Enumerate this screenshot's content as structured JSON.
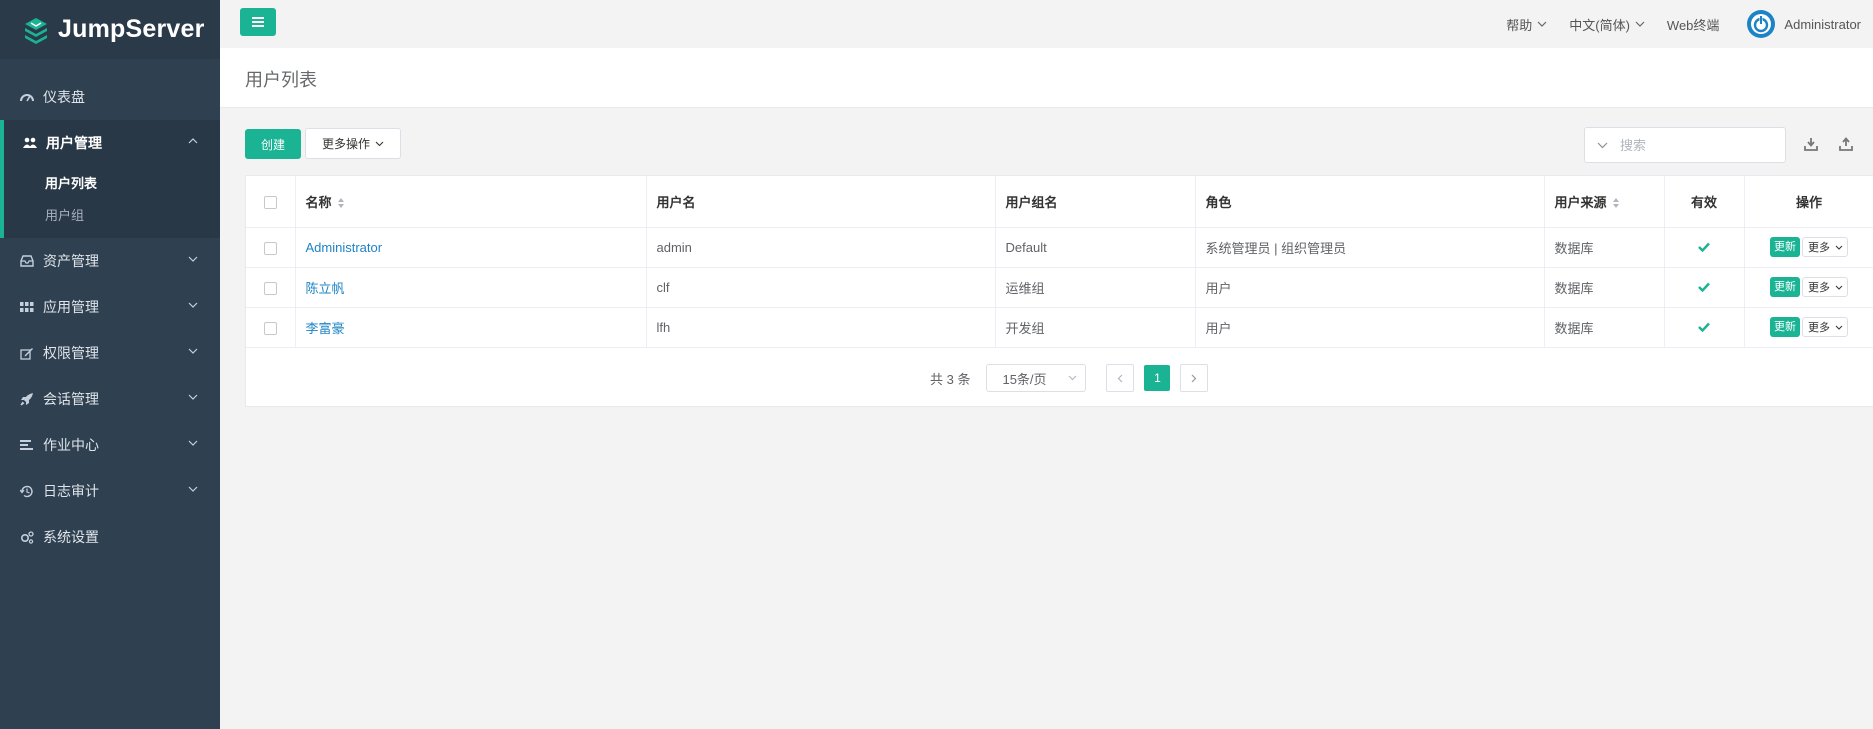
{
  "app": {
    "logo_text": "JumpServer"
  },
  "sidebar": {
    "items": [
      {
        "label": "仪表盘",
        "icon": "dashboard-icon"
      },
      {
        "label": "用户管理",
        "icon": "users-icon",
        "expanded": true,
        "children": [
          {
            "label": "用户列表",
            "current": true
          },
          {
            "label": "用户组"
          }
        ]
      },
      {
        "label": "资产管理",
        "icon": "inbox-icon"
      },
      {
        "label": "应用管理",
        "icon": "grid-icon"
      },
      {
        "label": "权限管理",
        "icon": "edit-icon"
      },
      {
        "label": "会话管理",
        "icon": "rocket-icon"
      },
      {
        "label": "作业中心",
        "icon": "tasks-icon"
      },
      {
        "label": "日志审计",
        "icon": "history-icon"
      },
      {
        "label": "系统设置",
        "icon": "gears-icon"
      }
    ]
  },
  "topbar": {
    "help": "帮助",
    "language": "中文(简体)",
    "web_terminal": "Web终端",
    "user": "Administrator"
  },
  "page": {
    "title": "用户列表"
  },
  "toolbar": {
    "create": "创建",
    "more_actions": "更多操作",
    "search_placeholder": "搜索"
  },
  "table": {
    "headers": {
      "name": "名称",
      "username": "用户名",
      "groups": "用户组名",
      "role": "角色",
      "source": "用户来源",
      "active": "有效",
      "actions": "操作"
    },
    "rows": [
      {
        "name": "Administrator",
        "username": "admin",
        "groups": "Default",
        "role": "系统管理员 | 组织管理员",
        "source": "数据库",
        "active": true,
        "update": "更新",
        "more": "更多"
      },
      {
        "name": "陈立帆",
        "username": "clf",
        "groups": "运维组",
        "role": "用户",
        "source": "数据库",
        "active": true,
        "update": "更新",
        "more": "更多"
      },
      {
        "name": "李富豪",
        "username": "lfh",
        "groups": "开发组",
        "role": "用户",
        "source": "数据库",
        "active": true,
        "update": "更新",
        "more": "更多"
      }
    ]
  },
  "pagination": {
    "total": "共 3 条",
    "page_size": "15条/页",
    "current_page": "1"
  },
  "colors": {
    "accent": "#1ab394",
    "sidebar_bg": "#2f4050",
    "link": "#1c84c6"
  }
}
